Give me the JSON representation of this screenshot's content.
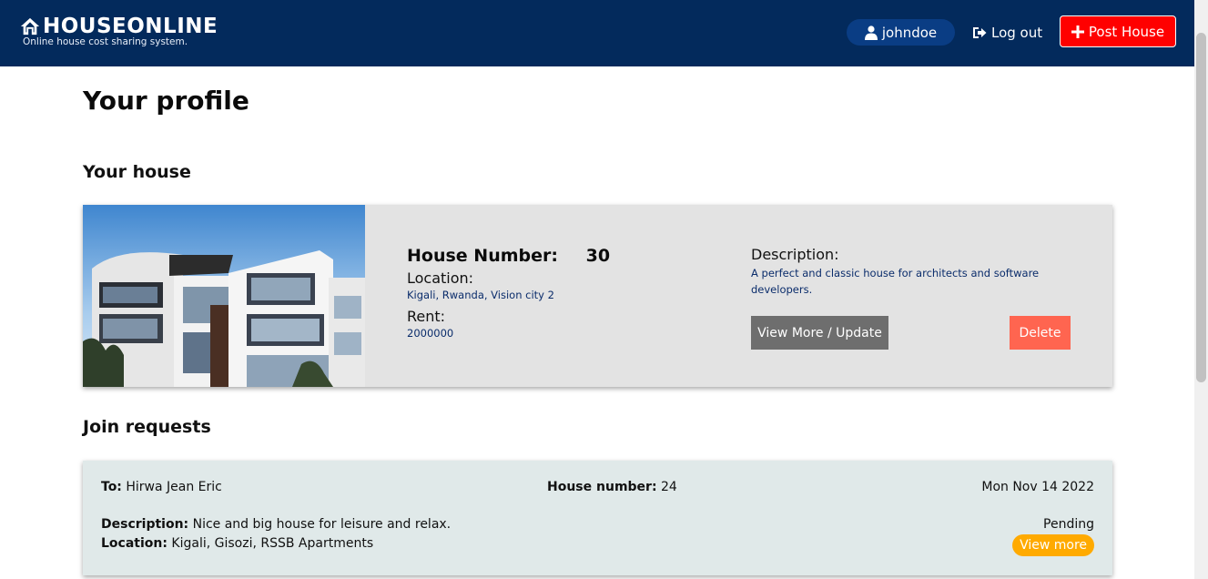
{
  "header": {
    "brand_title": "HOUSEONLINE",
    "brand_subtitle": "Online house cost sharing system.",
    "username": "johndoe",
    "logout_label": "Log out",
    "post_label": "Post House"
  },
  "page": {
    "title": "Your profile",
    "house_section_title": "Your house",
    "requests_section_title": "Join requests"
  },
  "house": {
    "number_label": "House Number:",
    "number": "30",
    "location_label": "Location:",
    "location": "Kigali, Rwanda, Vision city 2",
    "rent_label": "Rent:",
    "rent": "2000000",
    "description_label": "Description:",
    "description": "A perfect and classic house for architects and software developers.",
    "view_update_label": "View More / Update",
    "delete_label": "Delete"
  },
  "requests": [
    {
      "to_label": "To:",
      "to": "Hirwa Jean Eric",
      "house_number_label": "House number:",
      "house_number": "24",
      "date": "Mon Nov 14 2022",
      "description_label": "Description:",
      "description": "Nice and big house for leisure and relax.",
      "location_label": "Location:",
      "location": "Kigali, Gisozi, RSSB Apartments",
      "status": "Pending",
      "view_more_label": "View more"
    }
  ],
  "colors": {
    "navbar": "#032a5c",
    "user_pill": "#0a3d84",
    "post_button": "#ff0000",
    "view_button": "#6e6e6e",
    "delete_button": "#ff6550",
    "view_more": "#ffaa00"
  },
  "icons": {
    "brand": "home-icon",
    "user": "user-icon",
    "logout": "logout-icon",
    "post": "plus-icon"
  }
}
